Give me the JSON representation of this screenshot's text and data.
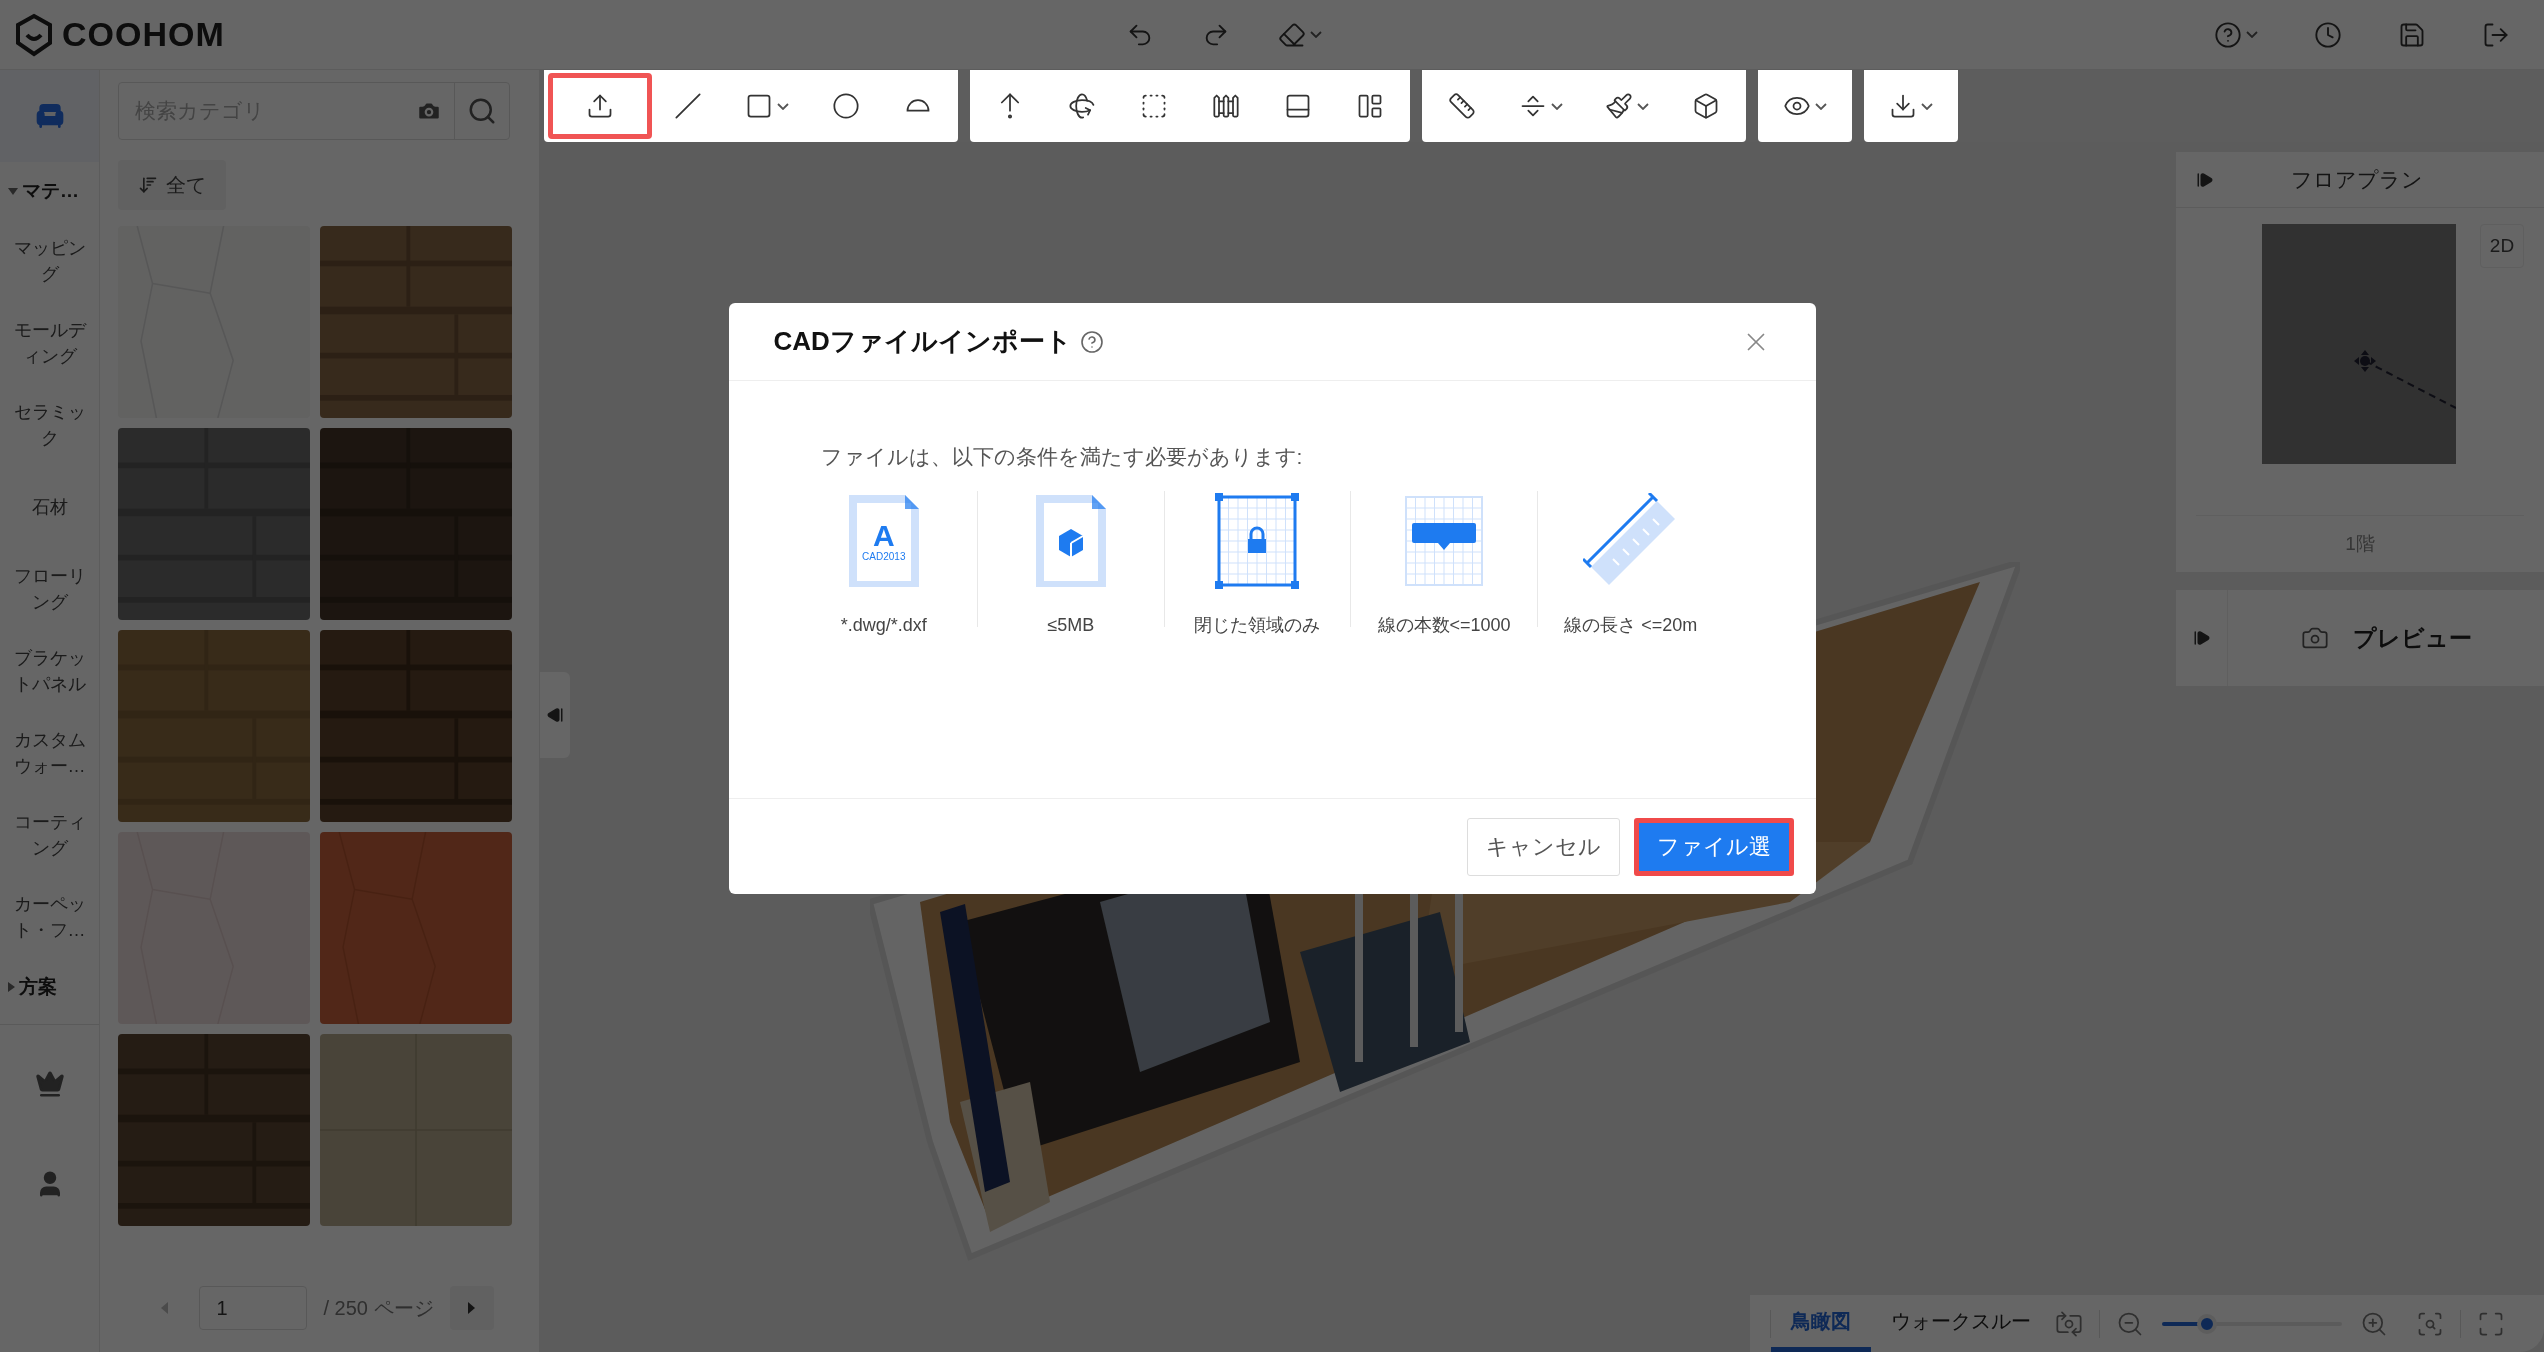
{
  "header": {
    "logo": "COOHOM",
    "center_tools": [
      {
        "kind": "undo",
        "dropdown": false
      },
      {
        "kind": "redo",
        "dropdown": false
      },
      {
        "kind": "eraser",
        "dropdown": true
      }
    ],
    "right_tools": [
      {
        "kind": "help",
        "dropdown": true
      },
      {
        "kind": "history",
        "dropdown": false
      },
      {
        "kind": "save",
        "dropdown": false
      },
      {
        "kind": "exit",
        "dropdown": false
      }
    ]
  },
  "left_rail": {
    "top_icons": [
      {
        "kind": "materials",
        "selected": true
      }
    ],
    "sections": [
      {
        "label": "マテ…",
        "expanded": true,
        "items": [
          "マッピング",
          "モールディング",
          "セラミック",
          "石材",
          "フローリング",
          "ブラケットパネル",
          "カスタムウォー…",
          "コーティング",
          "カーペット・フ…"
        ]
      },
      {
        "label": "方案",
        "expanded": false
      }
    ],
    "bottom_icons": [
      {
        "kind": "premium",
        "selected": false
      },
      {
        "kind": "account",
        "selected": false
      }
    ]
  },
  "material_panel": {
    "search": {
      "placeholder": "検索カテゴリ"
    },
    "filter": "全て",
    "pager": {
      "page": "1",
      "total": "/ 250 ページ"
    }
  },
  "toolbar": {
    "groups": [
      {
        "tools": [
          {
            "kind": "import",
            "dropdown": false,
            "highlighted": true
          },
          {
            "kind": "line",
            "dropdown": false,
            "highlighted": false
          },
          {
            "kind": "rectangle",
            "dropdown": true,
            "highlighted": false
          },
          {
            "kind": "circle",
            "dropdown": false,
            "highlighted": false
          },
          {
            "kind": "arc",
            "dropdown": false,
            "highlighted": false
          }
        ]
      },
      {
        "tools": [
          {
            "kind": "lift",
            "dropdown": false,
            "highlighted": false
          },
          {
            "kind": "rotate",
            "dropdown": false,
            "highlighted": false
          },
          {
            "kind": "area",
            "dropdown": false,
            "highlighted": false
          },
          {
            "kind": "fence",
            "dropdown": false,
            "highlighted": false
          },
          {
            "kind": "panel",
            "dropdown": false,
            "highlighted": false
          },
          {
            "kind": "layout",
            "dropdown": false,
            "highlighted": false
          }
        ]
      },
      {
        "tools": [
          {
            "kind": "measure",
            "dropdown": false,
            "highlighted": false
          },
          {
            "kind": "level",
            "dropdown": true,
            "highlighted": false
          },
          {
            "kind": "paint",
            "dropdown": true,
            "highlighted": false
          },
          {
            "kind": "cube",
            "dropdown": false,
            "highlighted": false
          }
        ]
      },
      {
        "tools": [
          {
            "kind": "view",
            "dropdown": true,
            "highlighted": false
          }
        ]
      },
      {
        "tools": [
          {
            "kind": "export",
            "dropdown": true,
            "highlighted": false
          }
        ]
      }
    ]
  },
  "right_panel": {
    "floor_plan": {
      "title": "フロアプラン",
      "view_button": "2D",
      "floor": "1階"
    },
    "preview": {
      "label": "プレビュー"
    }
  },
  "bottom_bar": {
    "tabs": [
      {
        "label": "鳥瞰図",
        "selected": true
      },
      {
        "label": "ウォークスルー",
        "selected": false
      }
    ],
    "zoom": {
      "level": 0.25
    }
  },
  "dialog": {
    "title": "CADファイルインポート",
    "intro": "ファイルは、以下の条件を満たす必要があります:",
    "conditions": [
      {
        "kind": "format",
        "label": "*.dwg/*.dxf",
        "icon_letter": "A",
        "icon_caption": "CAD2013"
      },
      {
        "kind": "size",
        "label": "≤5MB"
      },
      {
        "kind": "closed",
        "label": "閉じた領域のみ"
      },
      {
        "kind": "count",
        "label": "線の本数<=1000"
      },
      {
        "kind": "length",
        "label": "線の長さ <=20m"
      }
    ],
    "buttons": [
      {
        "label": "キャンセル",
        "kind": "secondary",
        "highlighted": false
      },
      {
        "label": "ファイル選",
        "kind": "primary",
        "highlighted": true
      }
    ]
  }
}
